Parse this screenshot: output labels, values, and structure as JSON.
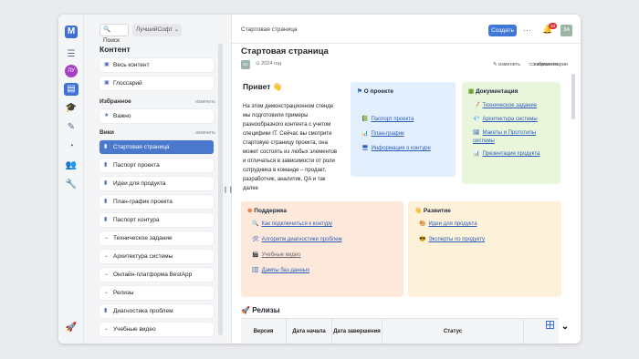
{
  "sidebar": {
    "search_label": "Поиск",
    "space_select": "ЛучшийСофт",
    "title": "Контент",
    "top_items": [
      {
        "label": "Весь контент"
      },
      {
        "label": "Глоссарий"
      }
    ],
    "favorites_section": "Избранное",
    "favorites_edit": "изменить",
    "favorites": [
      {
        "label": "Важно"
      }
    ],
    "wiki_section": "Вики",
    "wiki_edit": "изменить",
    "wiki_items": [
      {
        "label": "Стартовая страница",
        "active": true
      },
      {
        "label": "Паспорт проекта"
      },
      {
        "label": "Идеи для продукта"
      },
      {
        "label": "План-график проекта"
      },
      {
        "label": "Паспорт контура"
      },
      {
        "label": "Техническое задание"
      },
      {
        "label": "Архитектура системы"
      },
      {
        "label": "Онлайн-платформа BestApp"
      },
      {
        "label": "Релизы"
      },
      {
        "label": "Диагностика проблем"
      },
      {
        "label": "Учебные видео"
      }
    ],
    "rail_user_initials": "ЛУ"
  },
  "header": {
    "breadcrumb": "Стартовая страница",
    "create_button": "Создать",
    "notifications_count": "10",
    "user_initials": "ЗА"
  },
  "page": {
    "title": "Стартовая страница",
    "author_initials": "ЗА",
    "year": "2024 год",
    "actions": {
      "edit": "изменить",
      "favorite": "избранное",
      "comments": "комментарии"
    },
    "greeting": "Привет 👋",
    "intro": "На этом демонстрационном стенде мы подготовили примеры разнообразного контента с учетом специфики IT. Сейчас вы смотрите стартовую страницу проекта, она может состоять из любых элементов и отличаться в зависимости от роли сотрудника в команде – продакт, разработчик, аналитик, QA и так далее",
    "about": {
      "title": "О проекте",
      "links": [
        "Паспорт проекта",
        "План-график",
        "Информация о контуре"
      ]
    },
    "docs": {
      "title": "Документация",
      "links": [
        "Техническое задание",
        "Архитектура системы",
        "Макеты и Прототипы системы",
        "Презентация продукта"
      ]
    },
    "support": {
      "title": "Поддержка",
      "links": [
        "Как подключиться к контуру",
        "Алгоритм диагностики проблем",
        "Учебные видео",
        "Дампы баз данных"
      ]
    },
    "dev": {
      "title": "Развитие",
      "links": [
        "Идеи для продукта",
        "Эксперты по продукту"
      ]
    },
    "releases": {
      "title": "Релизы",
      "columns": [
        "Версия",
        "Дата начала",
        "Дата завершения",
        "Статус"
      ]
    }
  }
}
